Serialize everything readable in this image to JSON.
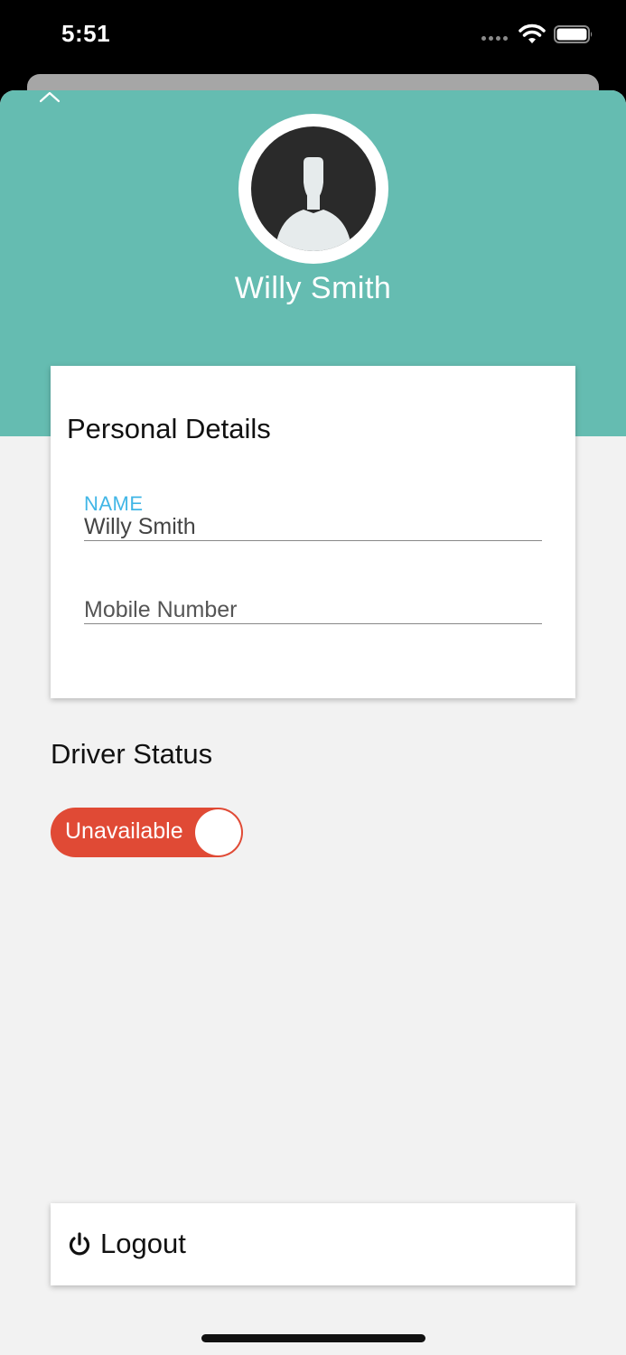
{
  "status_bar": {
    "time": "5:51",
    "icons": [
      "signal-icon",
      "wifi-icon",
      "battery-icon"
    ]
  },
  "profile": {
    "name": "Willy Smith",
    "avatar_icon": "user-silhouette-icon"
  },
  "personal_details": {
    "title": "Personal Details",
    "name_field": {
      "label": "NAME",
      "value": "Willy Smith"
    },
    "mobile_field": {
      "placeholder": "Mobile Number",
      "value": ""
    }
  },
  "driver_status": {
    "title": "Driver Status",
    "toggle_label": "Unavailable"
  },
  "logout": {
    "label": "Logout",
    "icon": "power-icon"
  },
  "colors": {
    "header": "#65bcb1",
    "toggle_off": "#e04a35",
    "field_label": "#41b6e6",
    "background": "#f2f2f2"
  }
}
